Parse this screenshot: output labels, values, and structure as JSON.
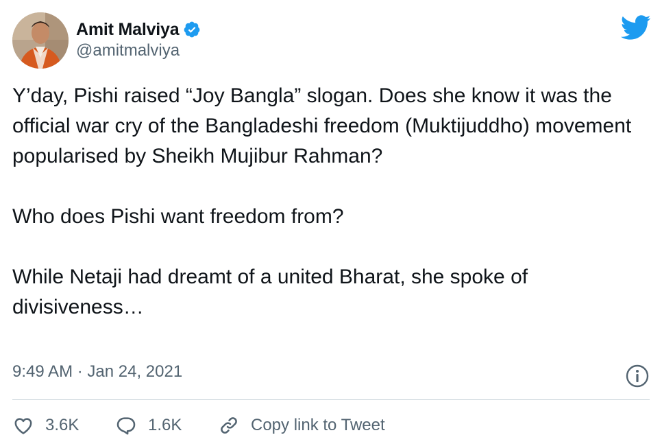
{
  "author": {
    "display_name": "Amit Malviya",
    "handle": "@amitmalviya",
    "verified": true,
    "avatar_icon": "avatar"
  },
  "brand": {
    "logo_icon": "twitter-bird-icon",
    "accent": "#1d9bf0"
  },
  "tweet": {
    "paragraphs": [
      "Y’day, Pishi raised “Joy Bangla” slogan. Does she know it was the official war cry of the Bangladeshi freedom (Muktijuddho) movement popularised by Sheikh Mujibur Rahman?",
      "Who does Pishi want freedom from?",
      "While Netaji had dreamt of a united Bharat, she spoke of divisiveness…"
    ],
    "timestamp": "9:49 AM · Jan 24, 2021"
  },
  "actions": {
    "likes": "3.6K",
    "replies": "1.6K",
    "copy_link": "Copy link to Tweet"
  },
  "icons": {
    "like": "heart-icon",
    "reply": "reply-bubble-icon",
    "copy": "link-icon",
    "info": "info-icon"
  },
  "colors": {
    "text": "#0f1419",
    "secondary": "#536471",
    "divider": "#cfd9de",
    "verified": "#1d9bf0"
  }
}
